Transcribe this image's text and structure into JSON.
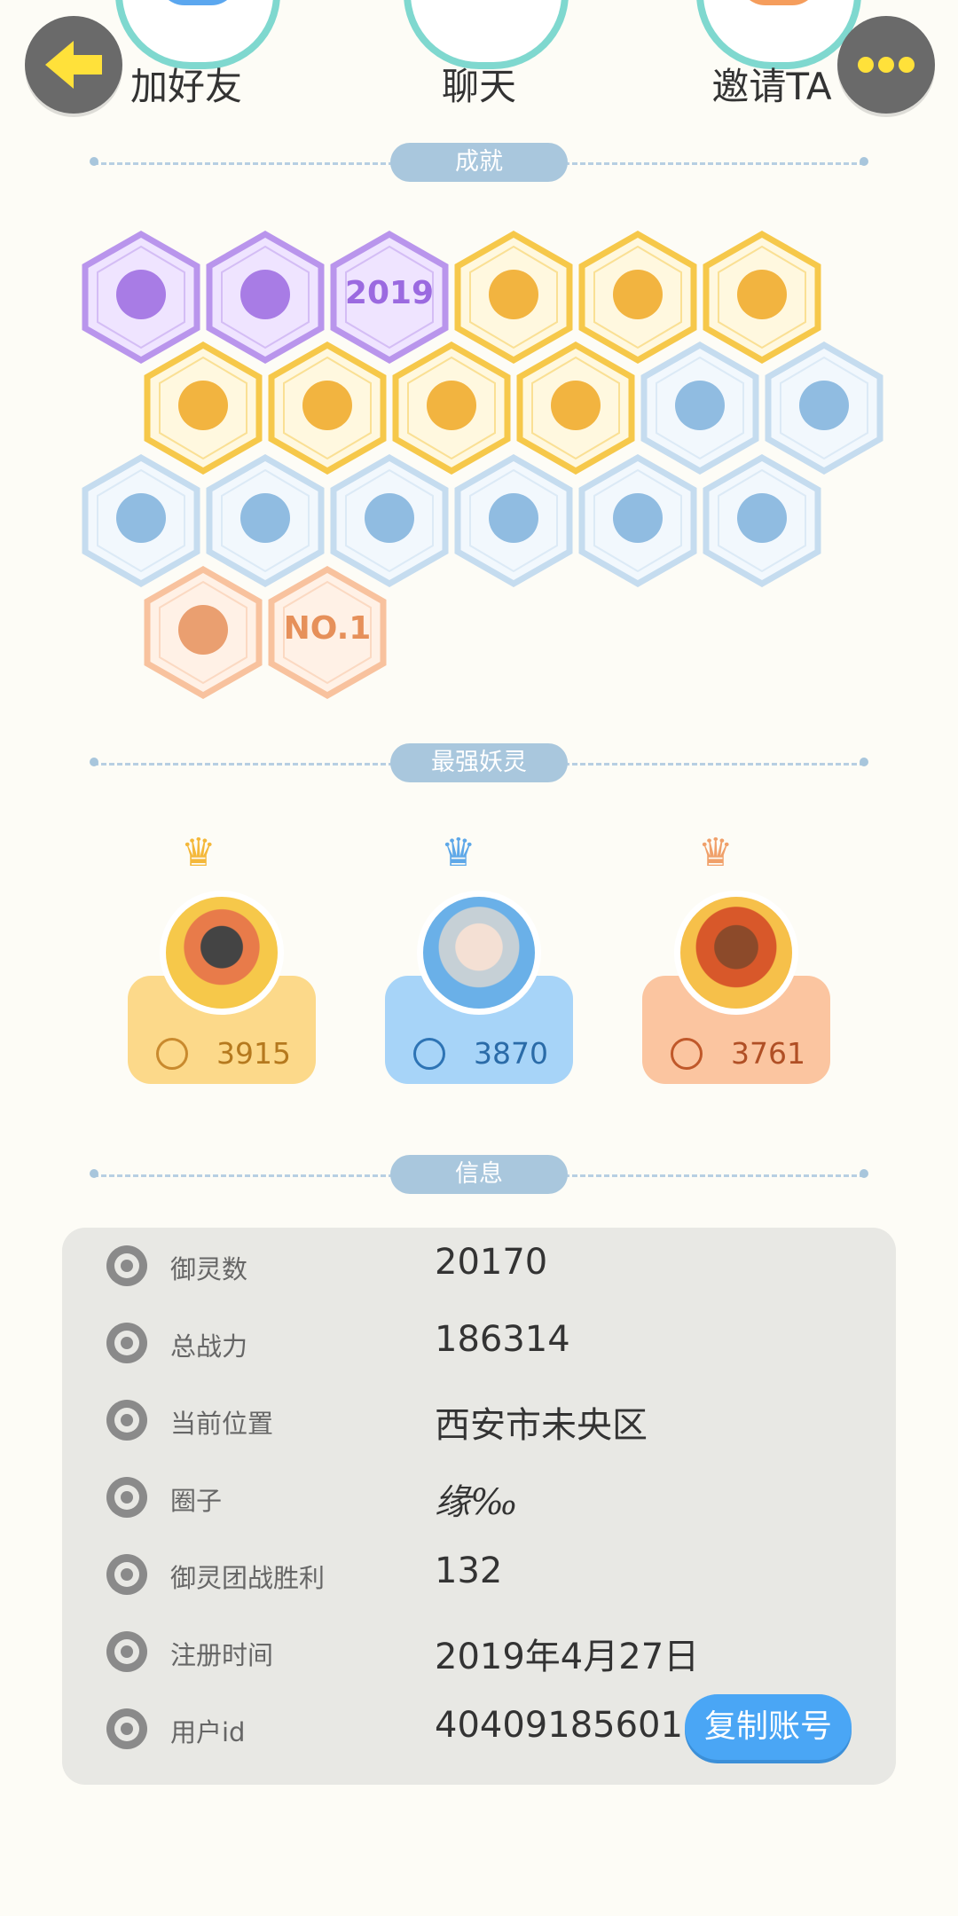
{
  "top": {
    "back_label": "",
    "actions": [
      {
        "label": "加好友",
        "icon": "add-friend-icon"
      },
      {
        "label": "聊天",
        "icon": "chat-icon"
      },
      {
        "label": "邀请TA",
        "icon": "invite-icon"
      }
    ],
    "more_label": ""
  },
  "sections": {
    "achievements": "成就",
    "strongest": "最强妖灵",
    "info": "信息"
  },
  "achievements": [
    {
      "icon": "devil-face-icon",
      "tier": "purple"
    },
    {
      "icon": "cat-spirit-icon",
      "tier": "purple"
    },
    {
      "icon": "2019-badge-icon",
      "tier": "purple",
      "text": "2019"
    },
    {
      "icon": "sneaker-icon",
      "tier": "gold"
    },
    {
      "icon": "lollipop-icon",
      "tier": "gold"
    },
    {
      "icon": "moon-sun-icon",
      "tier": "gold"
    },
    {
      "icon": "gold-bun-icon",
      "tier": "gold"
    },
    {
      "icon": "gold-egg-icon",
      "tier": "gold"
    },
    {
      "icon": "yinyang-orb-icon",
      "tier": "gold"
    },
    {
      "icon": "taiji-card-icon",
      "tier": "gold"
    },
    {
      "icon": "ice-creature-icon",
      "tier": "ice"
    },
    {
      "icon": "ice-fish-icon",
      "tier": "ice"
    },
    {
      "icon": "ice-shield-icon",
      "tier": "ice"
    },
    {
      "icon": "ice-horned-statue-icon",
      "tier": "ice"
    },
    {
      "icon": "ice-cat-icon",
      "tier": "ice"
    },
    {
      "icon": "ice-book-icon",
      "tier": "ice"
    },
    {
      "icon": "ice-belt-icon",
      "tier": "ice"
    },
    {
      "icon": "crossed-swords-icon",
      "tier": "ice"
    },
    {
      "icon": "stroller-icon",
      "tier": "peach"
    },
    {
      "icon": "no1-badge-icon",
      "tier": "peach",
      "text": "NO.1"
    }
  ],
  "spirits": [
    {
      "score": "3915",
      "theme": "gold"
    },
    {
      "score": "3870",
      "theme": "blue"
    },
    {
      "score": "3761",
      "theme": "peach"
    }
  ],
  "info": {
    "rows": [
      {
        "label": "御灵数",
        "value": "20170"
      },
      {
        "label": "总战力",
        "value": "186314"
      },
      {
        "label": "当前位置",
        "value": "西安市未央区"
      },
      {
        "label": "圈子",
        "value": "缘‰"
      },
      {
        "label": "御灵团战胜利",
        "value": "132"
      },
      {
        "label": "注册时间",
        "value": "2019年4月27日"
      },
      {
        "label": "用户id",
        "value": "40409185601"
      }
    ],
    "copy_button": "复制账号"
  },
  "colors": {
    "background": "#fdfcf6",
    "section_pill": "#a9c7dd",
    "copy_button": "#4aa6f5",
    "panel": "#e8e8e4",
    "gold": "#f6c84a",
    "blue": "#9fd0f5",
    "peach": "#f8c29e",
    "purple": "#b995ec",
    "ice": "#c5dcef"
  }
}
